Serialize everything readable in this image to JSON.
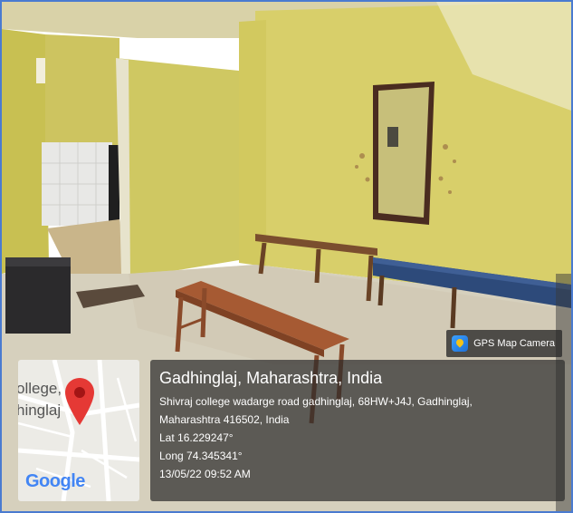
{
  "badge": {
    "label": "GPS Map Camera",
    "icon": "gps-map-camera-icon"
  },
  "map": {
    "label_line1": "ollege,",
    "label_line2": "hinglaj",
    "logo": "Google",
    "pin_icon": "map-pin-icon",
    "pin_color": "#e53935"
  },
  "location": {
    "title": "Gadhinglaj, Maharashtra, India",
    "address_line1": "Shivraj college wadarge road gadhinglaj, 68HW+J4J, Gadhinglaj,",
    "address_line2": "Maharashtra 416502, India",
    "latitude": "Lat 16.229247°",
    "longitude": "Long 74.345341°",
    "timestamp": "13/05/22 09:52 AM"
  },
  "colors": {
    "frame_border": "#4a7bd0",
    "wall": "#d8cf6a",
    "bench_blue": "#2d4a7a",
    "bench_wood": "#a65a33"
  }
}
